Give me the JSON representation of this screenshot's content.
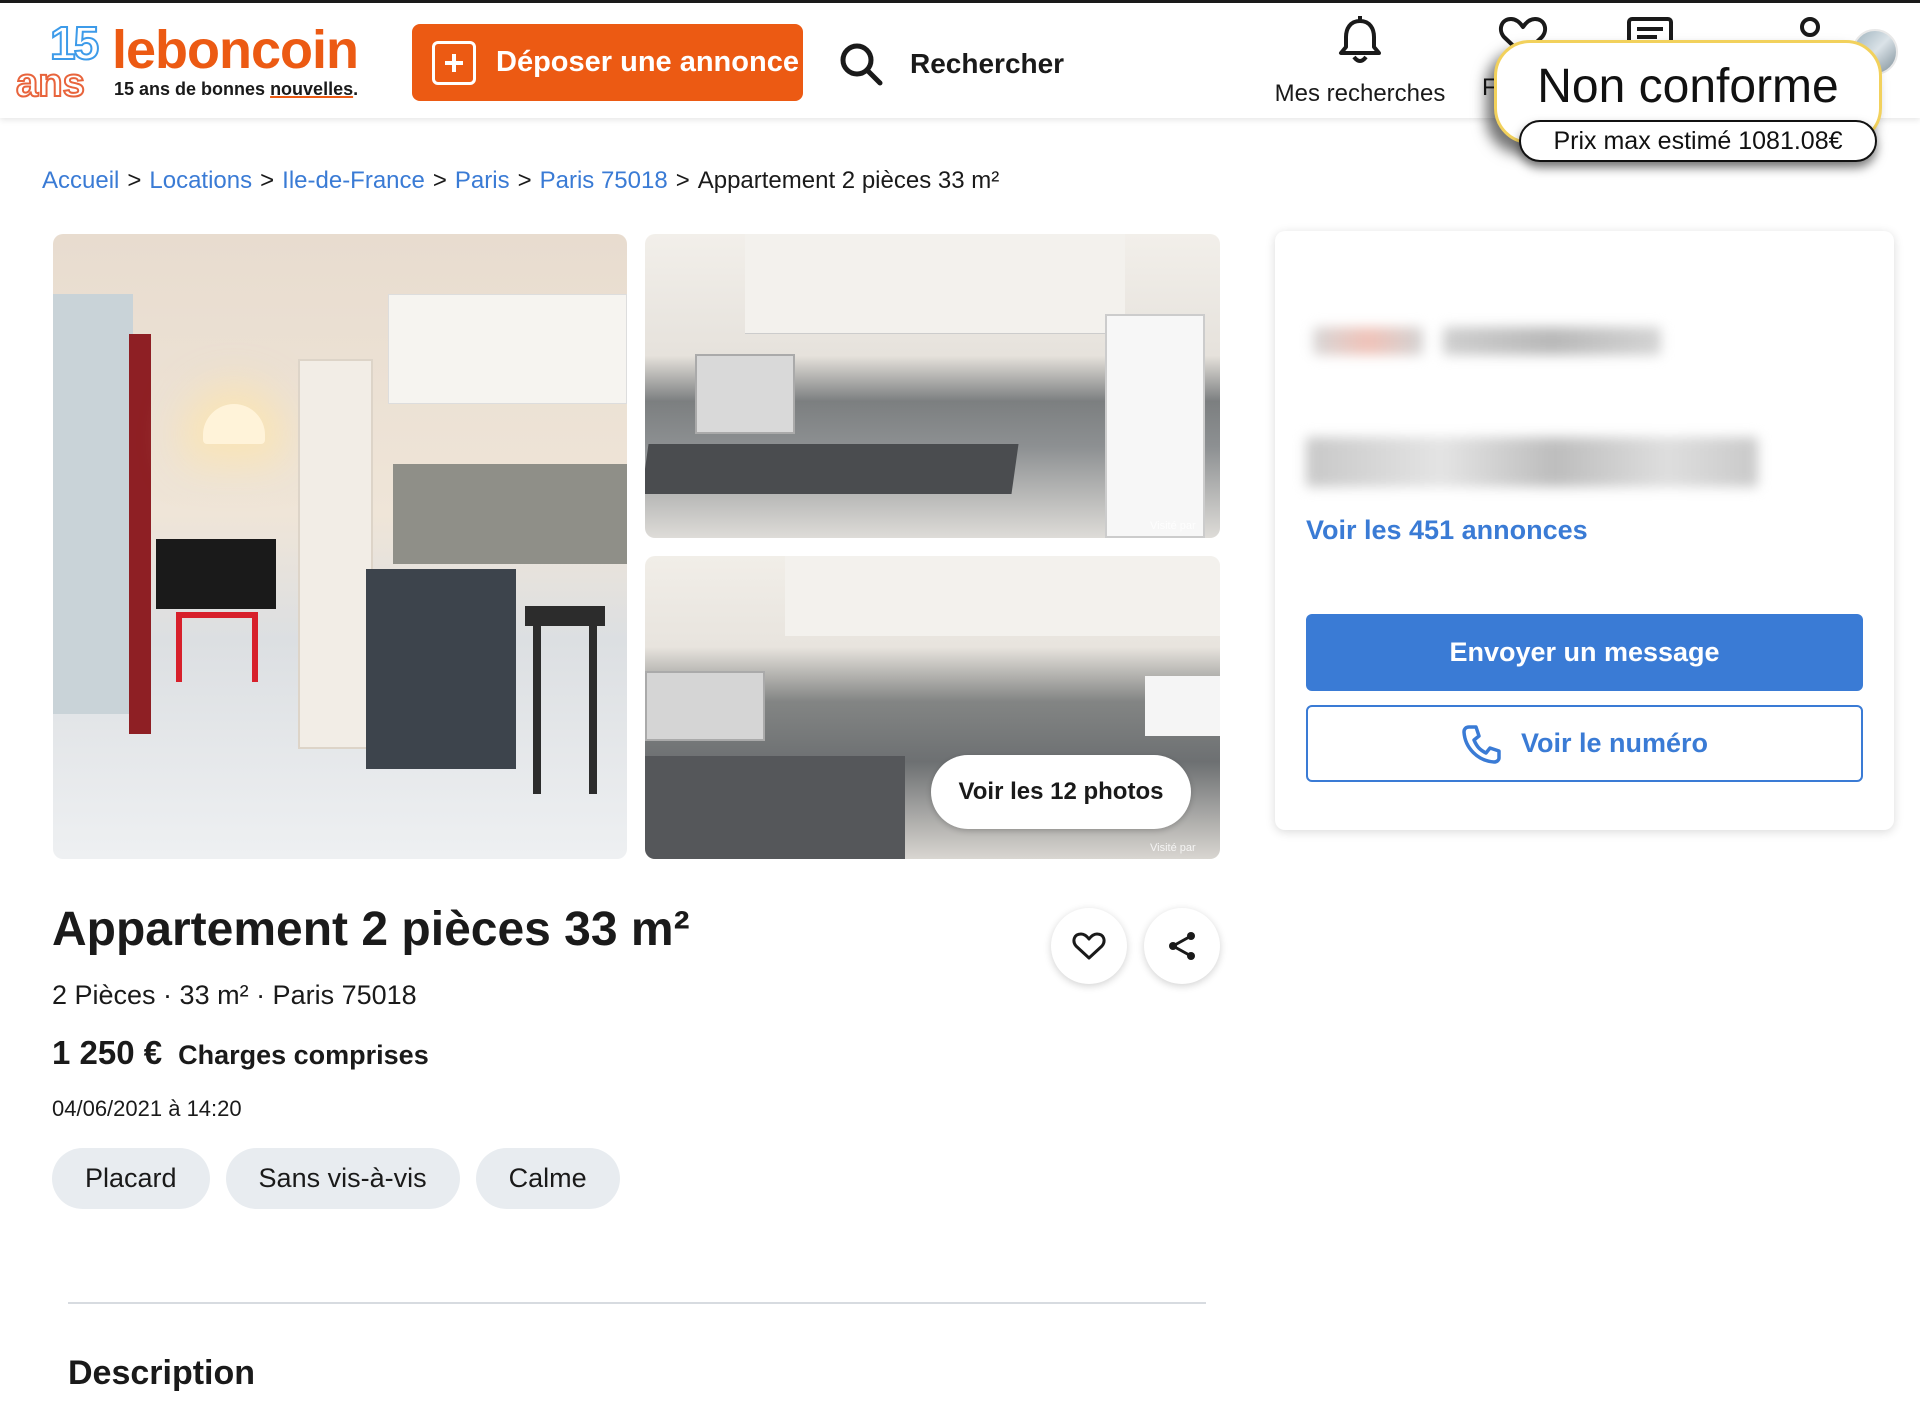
{
  "logo": {
    "anniv_number": "15",
    "anniv_word": "ans",
    "brand": "leboncoin",
    "tagline_start": "15 ans de bonnes ",
    "tagline_highlight": "nouvelles",
    "tagline_end": "."
  },
  "header": {
    "deposer_label": "Déposer une annonce",
    "search_label": "Rechercher",
    "mes_recherches_label": "Mes recherches",
    "favoris_label_partial": "F",
    "icons": [
      "plus-icon",
      "search-icon",
      "bell-icon",
      "heart-icon",
      "message-icon",
      "user-icon"
    ]
  },
  "overlay": {
    "status": "Non conforme",
    "estimate": "Prix max estimé 1081.08€"
  },
  "breadcrumb": {
    "items": [
      "Accueil",
      "Locations",
      "Ile-de-France",
      "Paris",
      "Paris 75018"
    ],
    "current": "Appartement 2 pièces 33 m²",
    "separator": ">"
  },
  "gallery": {
    "voir_photos_label": "Voir les 12 photos",
    "watermark": "Visité par"
  },
  "listing": {
    "title": "Appartement 2 pièces 33 m²",
    "subline": "2 Pièces · 33 m² · Paris 75018",
    "price": "1 250 €",
    "charges": "Charges comprises",
    "date": "04/06/2021 à 14:20",
    "tags": [
      "Placard",
      "Sans vis-à-vis",
      "Calme"
    ]
  },
  "description": {
    "title": "Description"
  },
  "seller": {
    "voir_annonces_label": "Voir les 451 annonces",
    "message_button": "Envoyer un message",
    "numero_button": "Voir le numéro"
  },
  "colors": {
    "brand_orange": "#ec5a13",
    "link_blue": "#3a7bd5",
    "tag_bg": "#e8ecf0",
    "overlay_border": "#f2d15c"
  }
}
